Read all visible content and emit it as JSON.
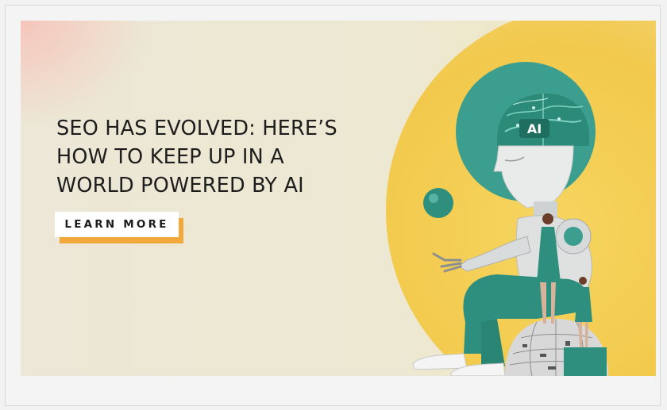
{
  "banner": {
    "headline_lines": [
      "SEO HAS EVOLVED: HERE’S",
      "HOW TO KEEP UP IN A",
      "WORLD POWERED BY AI"
    ],
    "cta_label": "LEARN MORE"
  },
  "illustration": {
    "head_badge": "AI"
  },
  "colors": {
    "accent_orange": "#f2a93b",
    "teal": "#3b9e8e",
    "sun_yellow": "#f2c94c",
    "background_cream": "#ede8d2"
  }
}
